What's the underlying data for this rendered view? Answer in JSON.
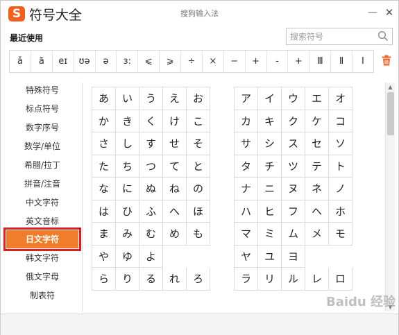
{
  "window": {
    "title": "搜狗输入法",
    "app_title": "符号大全",
    "logo_letter": "S"
  },
  "recent": {
    "label": "最近使用",
    "items": [
      "ǎ",
      "ā",
      "eɪ",
      "ʊə",
      "ə",
      "ɜ:",
      "⩽",
      "⩾",
      "÷",
      "×",
      "−",
      "+",
      "-",
      "+",
      "Ⅲ",
      "Ⅱ",
      "Ⅰ"
    ]
  },
  "search": {
    "placeholder": "搜索符号"
  },
  "sidebar": {
    "items": [
      "特殊符号",
      "标点符号",
      "数字序号",
      "数学/单位",
      "希腊/拉丁",
      "拼音/注音",
      "中文字符",
      "英文音标",
      "日文字符",
      "韩文字符",
      "俄文字母",
      "制表符"
    ],
    "active_index": 8
  },
  "hiragana": {
    "rows": [
      [
        "あ",
        "い",
        "う",
        "え",
        "お"
      ],
      [
        "か",
        "き",
        "く",
        "け",
        "こ"
      ],
      [
        "さ",
        "し",
        "す",
        "せ",
        "そ"
      ],
      [
        "た",
        "ち",
        "つ",
        "て",
        "と"
      ],
      [
        "な",
        "に",
        "ぬ",
        "ね",
        "の"
      ],
      [
        "は",
        "ひ",
        "ふ",
        "へ",
        "ほ"
      ],
      [
        "ま",
        "み",
        "む",
        "め",
        "も"
      ],
      [
        "や",
        "ゆ",
        "よ",
        "",
        ""
      ],
      [
        "ら",
        "り",
        "る",
        "れ",
        "ろ"
      ]
    ]
  },
  "katakana": {
    "rows": [
      [
        "ア",
        "イ",
        "ウ",
        "エ",
        "オ"
      ],
      [
        "カ",
        "キ",
        "ク",
        "ケ",
        "コ"
      ],
      [
        "サ",
        "シ",
        "ス",
        "セ",
        "ソ"
      ],
      [
        "タ",
        "チ",
        "ツ",
        "テ",
        "ト"
      ],
      [
        "ナ",
        "ニ",
        "ヌ",
        "ネ",
        "ノ"
      ],
      [
        "ハ",
        "ヒ",
        "フ",
        "ヘ",
        "ホ"
      ],
      [
        "マ",
        "ミ",
        "ム",
        "メ",
        "モ"
      ],
      [
        "ヤ",
        "ユ",
        "ヨ",
        "",
        ""
      ],
      [
        "ラ",
        "リ",
        "ル",
        "レ",
        "ロ"
      ]
    ]
  },
  "watermark": "Baidu 经验",
  "colors": {
    "accent": "#f07d2c",
    "highlight_border": "#d42020",
    "logo": "#f2601f",
    "trash": "#e8642c"
  },
  "icons": [
    "sogou-logo-icon",
    "minimize-icon",
    "close-icon",
    "search-icon",
    "trash-icon",
    "scroll-up-icon",
    "scroll-down-icon"
  ]
}
